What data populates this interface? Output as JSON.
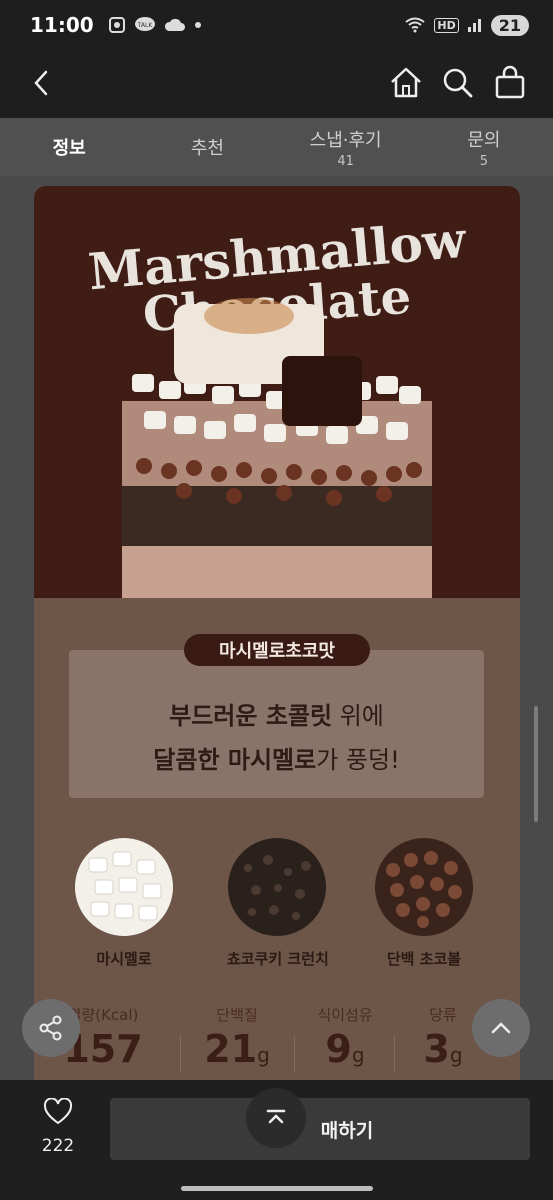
{
  "status": {
    "time": "11:00",
    "battery": "21",
    "hd": "HD",
    "talk": "TALK"
  },
  "header": {
    "back_icon": "chevron-left-icon",
    "home_icon": "home-icon",
    "search_icon": "search-icon",
    "bag_icon": "shopping-bag-icon"
  },
  "tabs": [
    {
      "label": "정보",
      "count": ""
    },
    {
      "label": "추천",
      "count": ""
    },
    {
      "label": "스냅·후기",
      "count": "41"
    },
    {
      "label": "문의",
      "count": "5"
    }
  ],
  "hero": {
    "title_line1": "Marshmallow",
    "title_line2": "Chocolate"
  },
  "flavor": {
    "badge": "마시멜로초코맛",
    "line1_bold": "부드러운 초콜릿",
    "line1_rest": " 위에",
    "line2_bold": "달콤한 마시멜로",
    "line2_rest": "가 풍덩!"
  },
  "ingredients": [
    {
      "label": "마시멜로"
    },
    {
      "label": "쵸코쿠키 크런치"
    },
    {
      "label": "단백 초코볼"
    }
  ],
  "nutrition": [
    {
      "label": "열량(Kcal)",
      "value": "157",
      "unit": ""
    },
    {
      "label": "단백질",
      "value": "21",
      "unit": "g"
    },
    {
      "label": "식이섬유",
      "value": "9",
      "unit": "g"
    },
    {
      "label": "당류",
      "value": "3",
      "unit": "g"
    }
  ],
  "bottom": {
    "like_count": "222",
    "buy_label": "구매하기",
    "buy_visible": "매하기"
  },
  "colors": {
    "hero_bg": "#3f1d14",
    "card_bg": "#6d5548",
    "badge_bg": "#3a1b14"
  }
}
